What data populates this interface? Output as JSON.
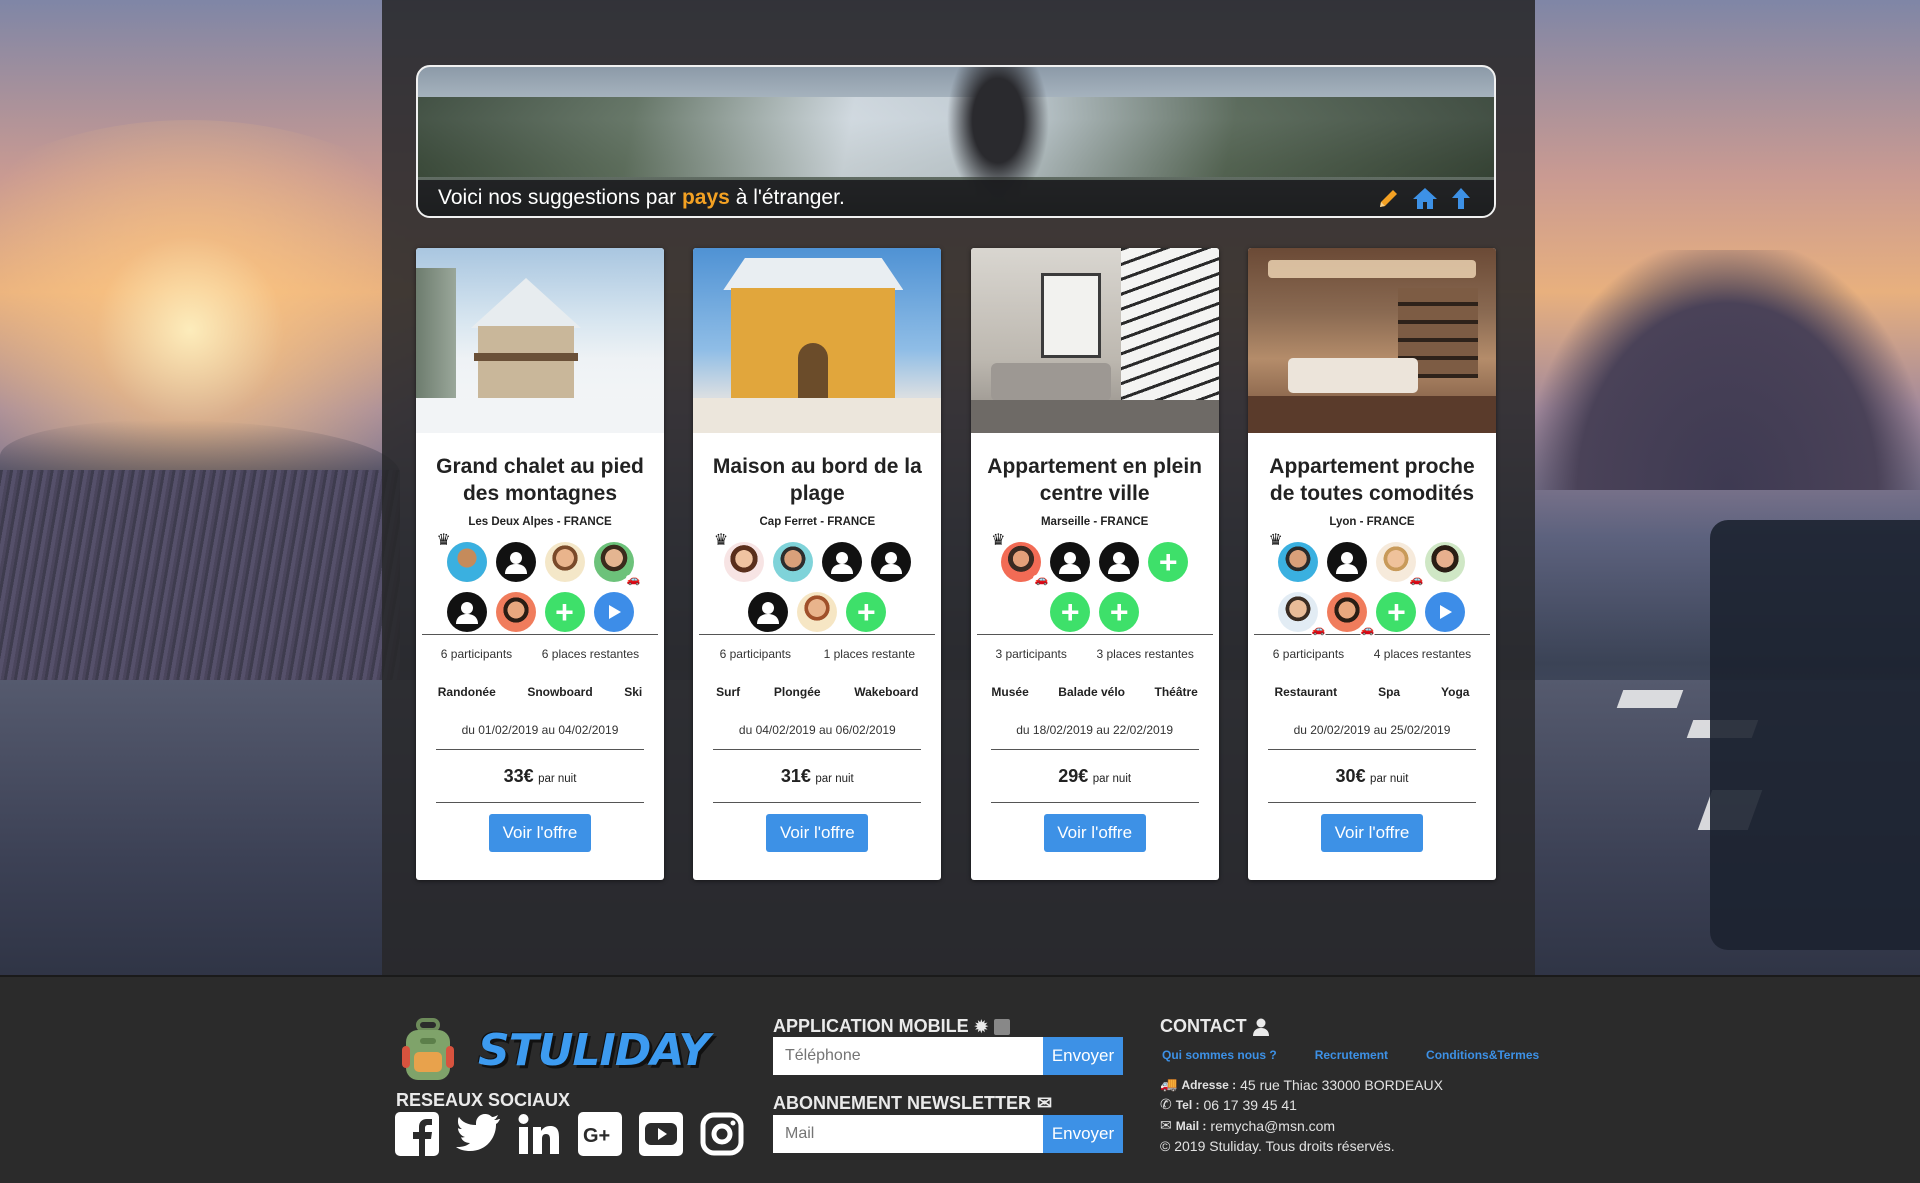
{
  "banner": {
    "text_before": "Voici nos suggestions par ",
    "highlight": "pays",
    "text_after": " à l'étranger."
  },
  "cards": [
    {
      "title": "Grand chalet au pied des montagnes",
      "location": "Les Deux Alpes - FRANCE",
      "participants": "6 participants",
      "places": "6 places restantes",
      "activities": [
        "Randonée",
        "Snowboard",
        "Ski"
      ],
      "dates": "du 01/02/2019 au 04/02/2019",
      "price": "33€",
      "price_unit": "par nuit",
      "button": "Voir l'offre"
    },
    {
      "title": "Maison au bord de la plage",
      "location": "Cap Ferret - FRANCE",
      "participants": "6 participants",
      "places": "1 places restante",
      "activities": [
        "Surf",
        "Plongée",
        "Wakeboard"
      ],
      "dates": "du 04/02/2019 au 06/02/2019",
      "price": "31€",
      "price_unit": "par nuit",
      "button": "Voir l'offre"
    },
    {
      "title": "Appartement en plein centre ville",
      "location": "Marseille - FRANCE",
      "participants": "3 participants",
      "places": "3 places restantes",
      "activities": [
        "Musée",
        "Balade vélo",
        "Théâtre"
      ],
      "dates": "du 18/02/2019 au 22/02/2019",
      "price": "29€",
      "price_unit": "par nuit",
      "button": "Voir l'offre"
    },
    {
      "title": "Appartement proche de toutes comodités",
      "location": "Lyon - FRANCE",
      "participants": "6 participants",
      "places": "4 places restantes",
      "activities": [
        "Restaurant",
        "Spa",
        "Yoga"
      ],
      "dates": "du 20/02/2019 au 25/02/2019",
      "price": "30€",
      "price_unit": "par nuit",
      "button": "Voir l'offre"
    }
  ],
  "footer": {
    "brand": "STULIDAY",
    "social_title": "RESEAUX SOCIAUX",
    "app_title": "APPLICATION MOBILE",
    "phone_placeholder": "Téléphone",
    "send_label": "Envoyer",
    "newsletter_title": "ABONNEMENT NEWSLETTER",
    "mail_placeholder": "Mail",
    "contact_title": "CONTACT",
    "links": [
      "Qui sommes nous ?",
      "Recrutement",
      "Conditions&Termes"
    ],
    "address_label": "Adresse :",
    "address": "45 rue Thiac 33000 BORDEAUX",
    "tel_label": "Tel :",
    "tel": "06 17 39 45 41",
    "mail_label": "Mail :",
    "mail": "remycha@msn.com",
    "copyright": "© 2019 Stuliday. Tous droits réservés."
  },
  "colors": {
    "accent": "#3d91e6",
    "highlight": "#f4a123",
    "add": "#3ee06a"
  }
}
